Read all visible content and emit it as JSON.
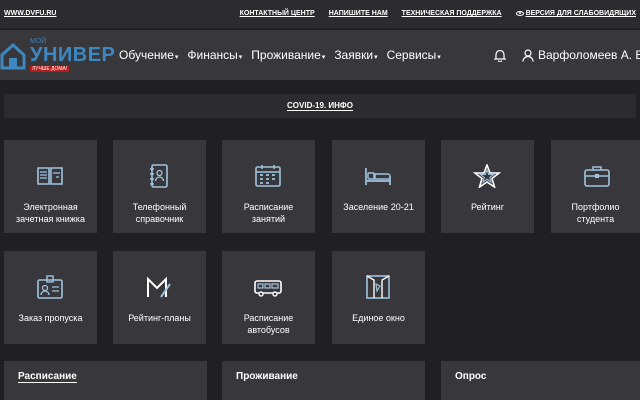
{
  "topbar": {
    "site": "WWW.DVFU.RU",
    "links": [
      "КОНТАКТНЫЙ ЦЕНТР",
      "НАПИШИТЕ НАМ",
      "ТЕХНИЧЕСКАЯ ПОДДЕРЖКА",
      "ВЕРСИЯ ДЛЯ СЛАБОВИДЯЩИХ"
    ]
  },
  "logo": {
    "small": "МОЙ",
    "name": "УНИВЕР",
    "slogan": "ЛУЧШЕ ДОМА!"
  },
  "menu": [
    "Обучение",
    "Финансы",
    "Проживание",
    "Заявки",
    "Сервисы"
  ],
  "user": {
    "name": "Варфоломеев А. В."
  },
  "covid": {
    "label": "COVID-19. ИНФО"
  },
  "tiles": [
    {
      "label": "Электронная зачетная книжка",
      "icon": "book-icon"
    },
    {
      "label": "Телефонный справочник",
      "icon": "phonebook-icon"
    },
    {
      "label": "Расписание занятий",
      "icon": "calendar-icon"
    },
    {
      "label": "Заселение 20-21",
      "icon": "bed-icon"
    },
    {
      "label": "Рейтинг",
      "icon": "star-icon"
    },
    {
      "label": "Портфолио студента",
      "icon": "briefcase-icon"
    },
    {
      "label": "Заказ пропуска",
      "icon": "badge-icon"
    },
    {
      "label": "Рейтинг-планы",
      "icon": "rating-plan-icon"
    },
    {
      "label": "Расписание автобусов",
      "icon": "bus-icon"
    },
    {
      "label": "Единое окно",
      "icon": "window-icon"
    }
  ],
  "panels": [
    "Расписание",
    "Проживание",
    "Опрос"
  ],
  "colors": {
    "accent": "#3e88c2",
    "icon": "#9fc3de",
    "bg": "#202024",
    "tile": "#38383c"
  }
}
